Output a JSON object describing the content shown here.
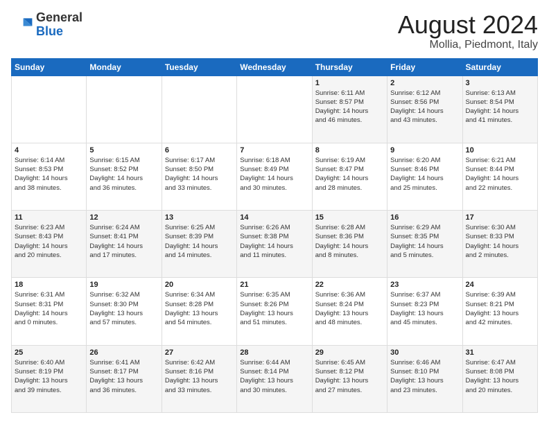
{
  "header": {
    "logo_general": "General",
    "logo_blue": "Blue",
    "month_title": "August 2024",
    "subtitle": "Mollia, Piedmont, Italy"
  },
  "days_of_week": [
    "Sunday",
    "Monday",
    "Tuesday",
    "Wednesday",
    "Thursday",
    "Friday",
    "Saturday"
  ],
  "weeks": [
    [
      {
        "day": "",
        "info": ""
      },
      {
        "day": "",
        "info": ""
      },
      {
        "day": "",
        "info": ""
      },
      {
        "day": "",
        "info": ""
      },
      {
        "day": "1",
        "info": "Sunrise: 6:11 AM\nSunset: 8:57 PM\nDaylight: 14 hours\nand 46 minutes."
      },
      {
        "day": "2",
        "info": "Sunrise: 6:12 AM\nSunset: 8:56 PM\nDaylight: 14 hours\nand 43 minutes."
      },
      {
        "day": "3",
        "info": "Sunrise: 6:13 AM\nSunset: 8:54 PM\nDaylight: 14 hours\nand 41 minutes."
      }
    ],
    [
      {
        "day": "4",
        "info": "Sunrise: 6:14 AM\nSunset: 8:53 PM\nDaylight: 14 hours\nand 38 minutes."
      },
      {
        "day": "5",
        "info": "Sunrise: 6:15 AM\nSunset: 8:52 PM\nDaylight: 14 hours\nand 36 minutes."
      },
      {
        "day": "6",
        "info": "Sunrise: 6:17 AM\nSunset: 8:50 PM\nDaylight: 14 hours\nand 33 minutes."
      },
      {
        "day": "7",
        "info": "Sunrise: 6:18 AM\nSunset: 8:49 PM\nDaylight: 14 hours\nand 30 minutes."
      },
      {
        "day": "8",
        "info": "Sunrise: 6:19 AM\nSunset: 8:47 PM\nDaylight: 14 hours\nand 28 minutes."
      },
      {
        "day": "9",
        "info": "Sunrise: 6:20 AM\nSunset: 8:46 PM\nDaylight: 14 hours\nand 25 minutes."
      },
      {
        "day": "10",
        "info": "Sunrise: 6:21 AM\nSunset: 8:44 PM\nDaylight: 14 hours\nand 22 minutes."
      }
    ],
    [
      {
        "day": "11",
        "info": "Sunrise: 6:23 AM\nSunset: 8:43 PM\nDaylight: 14 hours\nand 20 minutes."
      },
      {
        "day": "12",
        "info": "Sunrise: 6:24 AM\nSunset: 8:41 PM\nDaylight: 14 hours\nand 17 minutes."
      },
      {
        "day": "13",
        "info": "Sunrise: 6:25 AM\nSunset: 8:39 PM\nDaylight: 14 hours\nand 14 minutes."
      },
      {
        "day": "14",
        "info": "Sunrise: 6:26 AM\nSunset: 8:38 PM\nDaylight: 14 hours\nand 11 minutes."
      },
      {
        "day": "15",
        "info": "Sunrise: 6:28 AM\nSunset: 8:36 PM\nDaylight: 14 hours\nand 8 minutes."
      },
      {
        "day": "16",
        "info": "Sunrise: 6:29 AM\nSunset: 8:35 PM\nDaylight: 14 hours\nand 5 minutes."
      },
      {
        "day": "17",
        "info": "Sunrise: 6:30 AM\nSunset: 8:33 PM\nDaylight: 14 hours\nand 2 minutes."
      }
    ],
    [
      {
        "day": "18",
        "info": "Sunrise: 6:31 AM\nSunset: 8:31 PM\nDaylight: 14 hours\nand 0 minutes."
      },
      {
        "day": "19",
        "info": "Sunrise: 6:32 AM\nSunset: 8:30 PM\nDaylight: 13 hours\nand 57 minutes."
      },
      {
        "day": "20",
        "info": "Sunrise: 6:34 AM\nSunset: 8:28 PM\nDaylight: 13 hours\nand 54 minutes."
      },
      {
        "day": "21",
        "info": "Sunrise: 6:35 AM\nSunset: 8:26 PM\nDaylight: 13 hours\nand 51 minutes."
      },
      {
        "day": "22",
        "info": "Sunrise: 6:36 AM\nSunset: 8:24 PM\nDaylight: 13 hours\nand 48 minutes."
      },
      {
        "day": "23",
        "info": "Sunrise: 6:37 AM\nSunset: 8:23 PM\nDaylight: 13 hours\nand 45 minutes."
      },
      {
        "day": "24",
        "info": "Sunrise: 6:39 AM\nSunset: 8:21 PM\nDaylight: 13 hours\nand 42 minutes."
      }
    ],
    [
      {
        "day": "25",
        "info": "Sunrise: 6:40 AM\nSunset: 8:19 PM\nDaylight: 13 hours\nand 39 minutes."
      },
      {
        "day": "26",
        "info": "Sunrise: 6:41 AM\nSunset: 8:17 PM\nDaylight: 13 hours\nand 36 minutes."
      },
      {
        "day": "27",
        "info": "Sunrise: 6:42 AM\nSunset: 8:16 PM\nDaylight: 13 hours\nand 33 minutes."
      },
      {
        "day": "28",
        "info": "Sunrise: 6:44 AM\nSunset: 8:14 PM\nDaylight: 13 hours\nand 30 minutes."
      },
      {
        "day": "29",
        "info": "Sunrise: 6:45 AM\nSunset: 8:12 PM\nDaylight: 13 hours\nand 27 minutes."
      },
      {
        "day": "30",
        "info": "Sunrise: 6:46 AM\nSunset: 8:10 PM\nDaylight: 13 hours\nand 23 minutes."
      },
      {
        "day": "31",
        "info": "Sunrise: 6:47 AM\nSunset: 8:08 PM\nDaylight: 13 hours\nand 20 minutes."
      }
    ]
  ]
}
